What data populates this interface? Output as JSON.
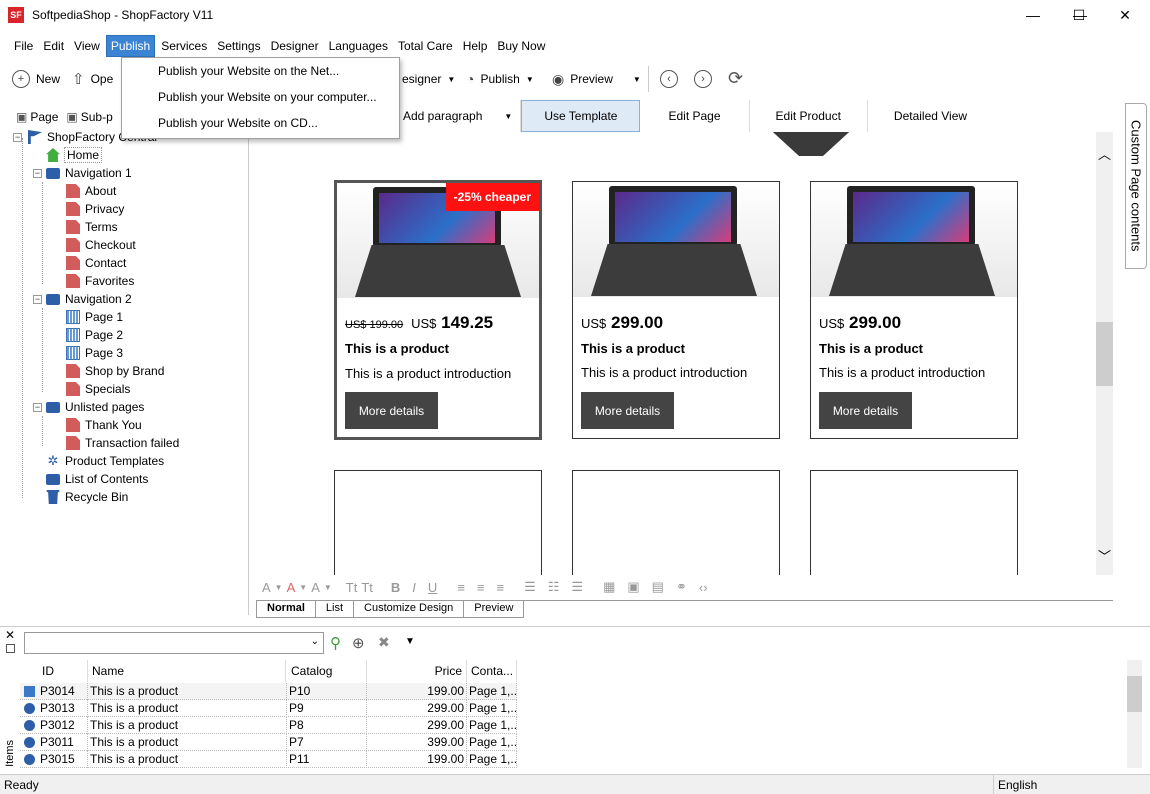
{
  "window": {
    "app_icon": "SF",
    "title": "SoftpediaShop - ShopFactory V11",
    "controls": {
      "minimize": "—",
      "maximize": "☐",
      "close": "✕"
    }
  },
  "menu": [
    "File",
    "Edit",
    "View",
    "Publish",
    "Services",
    "Settings",
    "Designer",
    "Languages",
    "Total Care",
    "Help",
    "Buy Now"
  ],
  "toolbar": {
    "new": "New",
    "open": "Ope",
    "designer": "esigner",
    "publish": "Publish",
    "preview": "Preview"
  },
  "publish_menu": [
    "Publish your Website on the Net...",
    "Publish your Website on your computer...",
    "Publish your Website on CD..."
  ],
  "tree_toolbar": {
    "page": "Page",
    "subpage": "Sub-p"
  },
  "tree": [
    {
      "label": "ShopFactory Central",
      "icon": "flag-icon"
    },
    {
      "label": "Home",
      "icon": "home-icon"
    },
    {
      "label": "Navigation 1",
      "icon": "folder-icon"
    },
    {
      "label": "About",
      "icon": "page-icon"
    },
    {
      "label": "Privacy",
      "icon": "page-icon"
    },
    {
      "label": "Terms",
      "icon": "page-icon"
    },
    {
      "label": "Checkout",
      "icon": "page-icon"
    },
    {
      "label": "Contact",
      "icon": "page-icon"
    },
    {
      "label": "Favorites",
      "icon": "page-icon"
    },
    {
      "label": "Navigation 2",
      "icon": "folder-icon"
    },
    {
      "label": "Page 1",
      "icon": "grid-page-icon"
    },
    {
      "label": "Page 2",
      "icon": "grid-page-icon"
    },
    {
      "label": "Page 3",
      "icon": "grid-page-icon"
    },
    {
      "label": "Shop by Brand",
      "icon": "page-icon"
    },
    {
      "label": "Specials",
      "icon": "page-icon"
    },
    {
      "label": "Unlisted pages",
      "icon": "folder-icon"
    },
    {
      "label": "Thank You",
      "icon": "page-icon"
    },
    {
      "label": "Transaction failed",
      "icon": "page-icon"
    },
    {
      "label": "Product Templates",
      "icon": "gear-icon"
    },
    {
      "label": "List of Contents",
      "icon": "folder-icon"
    },
    {
      "label": "Recycle Bin",
      "icon": "bin-icon"
    }
  ],
  "editor_tabs": {
    "add_paragraph": "Add paragraph",
    "use_template": "Use Template",
    "edit_page": "Edit Page",
    "edit_product": "Edit Product",
    "detailed_view": "Detailed View"
  },
  "products": [
    {
      "old_price": "US$ 199.00",
      "currency": "US$",
      "price": "149.25",
      "name": "This is a product",
      "intro": "This is a product introduction",
      "button": "More details",
      "badge": "-25% cheaper"
    },
    {
      "currency": "US$",
      "price": "299.00",
      "name": "This is a product",
      "intro": "This is a product introduction",
      "button": "More details"
    },
    {
      "currency": "US$",
      "price": "299.00",
      "name": "This is a product",
      "intro": "This is a product introduction",
      "button": "More details"
    }
  ],
  "view_tabs": [
    "Normal",
    "List",
    "Customize Design",
    "Preview"
  ],
  "side_tab": "Custom Page contents",
  "grid": {
    "headers": [
      "ID",
      "Name",
      "Catalog num...",
      "Price",
      "Conta..."
    ],
    "rows": [
      [
        "P3014",
        "This is a product",
        "P10",
        "199.00",
        "Page 1,..."
      ],
      [
        "P3013",
        "This is a product",
        "P9",
        "299.00",
        "Page 1,..."
      ],
      [
        "P3012",
        "This is a product",
        "P8",
        "299.00",
        "Page 1,..."
      ],
      [
        "P3011",
        "This is a product",
        "P7",
        "399.00",
        "Page 1,..."
      ],
      [
        "P3015",
        "This is a product",
        "P11",
        "199.00",
        "Page 1,..."
      ]
    ],
    "side_label": "Items"
  },
  "status": {
    "left": "Ready",
    "language": "English"
  },
  "colors": {
    "accent": "#3b84d3",
    "badge": "#ff1111",
    "button": "#444444",
    "folder": "#2e5ea8",
    "page": "#d25b5b"
  }
}
